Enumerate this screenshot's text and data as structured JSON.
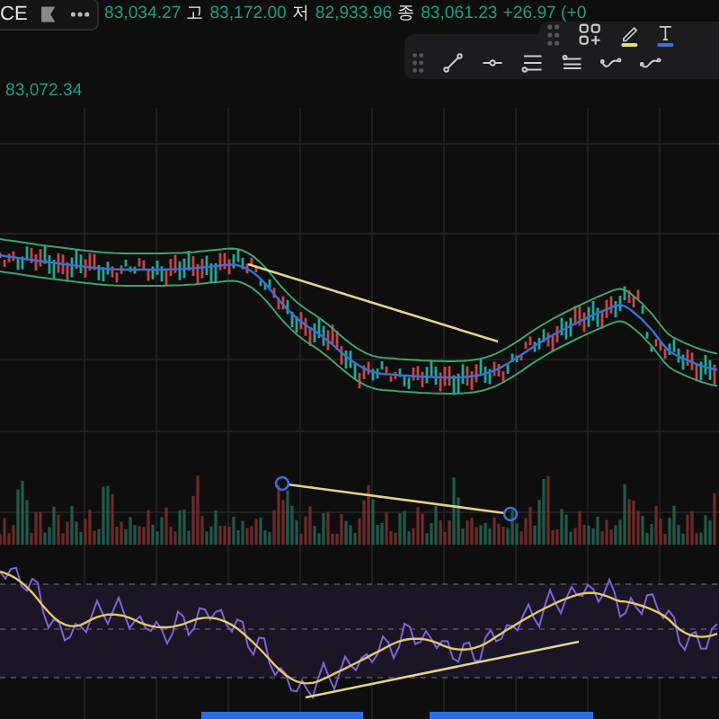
{
  "header": {
    "symbol": "CE",
    "fields": [
      {
        "kind": "value",
        "text": "83,034.27"
      },
      {
        "kind": "label",
        "text": "고"
      },
      {
        "kind": "value",
        "text": "83,172.00"
      },
      {
        "kind": "label",
        "text": "저"
      },
      {
        "kind": "value",
        "text": "82,933.96"
      },
      {
        "kind": "label",
        "text": "종"
      },
      {
        "kind": "value",
        "text": "83,061.23"
      },
      {
        "kind": "value",
        "text": "+26.97 (+0"
      }
    ]
  },
  "price_label": "83,072.34"
}
